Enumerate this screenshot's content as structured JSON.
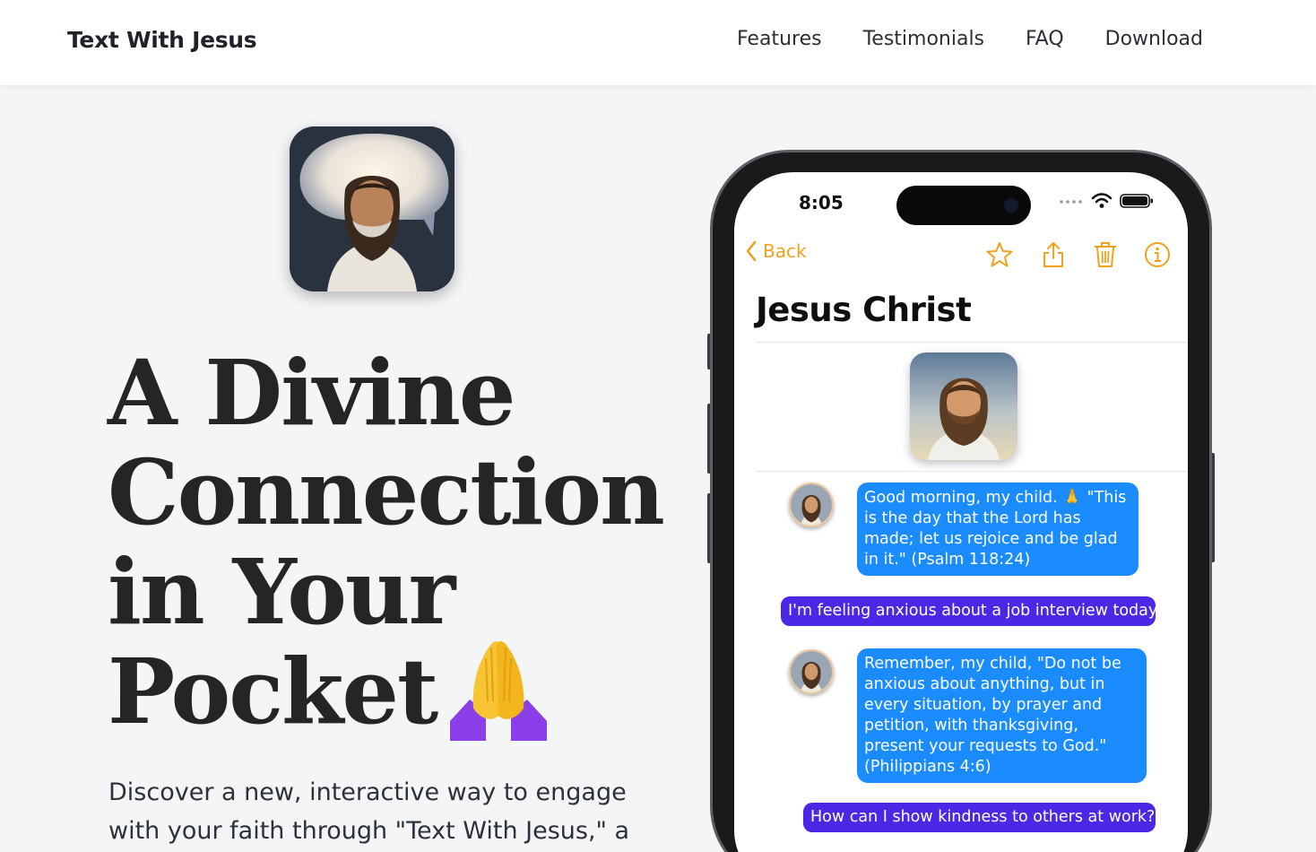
{
  "nav": {
    "brand": "Text With Jesus",
    "links": [
      "Features",
      "Testimonials",
      "FAQ",
      "Download"
    ]
  },
  "hero": {
    "headline_lines": [
      "A Divine",
      "Connection",
      "in Your",
      "Pocket"
    ],
    "emoji": "praying-hands",
    "subtext_lines": [
      "Discover a new, interactive way to engage",
      "with your faith through \"Text With Jesus,\" a"
    ]
  },
  "phone": {
    "status": {
      "time": "8:05"
    },
    "toolbar": {
      "back_label": "Back",
      "icons": [
        "star-icon",
        "share-icon",
        "trash-icon",
        "info-icon"
      ]
    },
    "contact_name": "Jesus Christ",
    "messages": [
      {
        "from": "jesus",
        "text": "Good morning, my child. 🙏 \"This is the day that the Lord has made; let us rejoice and be glad in it.\" (Psalm 118:24)"
      },
      {
        "from": "user",
        "text": "I'm feeling anxious about a job interview today."
      },
      {
        "from": "jesus",
        "text": "Remember, my child, \"Do not be anxious about anything, but in every situation, by prayer and petition, with thanksgiving, present your requests to God.\" (Philippians 4:6)"
      },
      {
        "from": "user",
        "text": "How can I show kindness to others at work?"
      }
    ]
  },
  "colors": {
    "accent_orange": "#f0a21d",
    "incoming_bubble": "#1a8cff",
    "outgoing_bubble": "#4b28e6",
    "page_bg": "#f4f5f7"
  }
}
